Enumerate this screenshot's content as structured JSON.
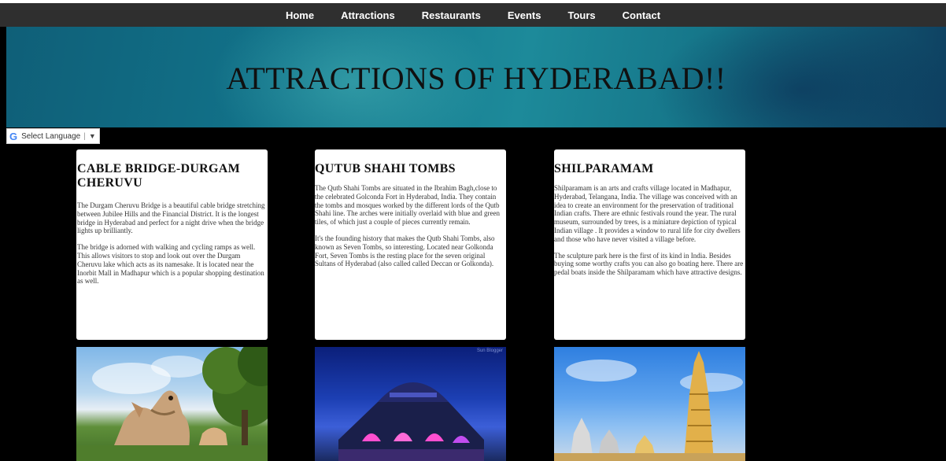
{
  "nav": {
    "items": [
      {
        "label": "Home"
      },
      {
        "label": "Attractions"
      },
      {
        "label": "Restaurants"
      },
      {
        "label": "Events"
      },
      {
        "label": "Tours"
      },
      {
        "label": "Contact"
      }
    ]
  },
  "hero": {
    "title": "ATTRACTIONS OF HYDERABAD!!"
  },
  "translate": {
    "label": "Select Language",
    "icon": "google-g-icon",
    "arrow": "▼"
  },
  "cards": [
    {
      "title": "CABLE BRIDGE-DURGAM CHERUVU",
      "p1": "The Durgam Cheruvu Bridge is a beautiful cable bridge stretching between Jubilee Hills and the Financial District. It is the longest bridge in Hyderabad and perfect for a night drive when the bridge lights up brilliantly.",
      "p2": "The bridge is adorned with walking and cycling ramps as well. This allows visitors to stop and look out over the Durgam Cheruvu lake which acts as its namesake. It is located near the Inorbit Mall in Madhapur which is a popular shopping destination as well."
    },
    {
      "title": "QUTUB SHAHI TOMBS",
      "p1": "The Qutb Shahi Tombs are situated in the Ibrahim Bagh,close to the celebrated Golconda Fort in Hyderabad, India. They contain the tombs and mosques worked by the different lords of the Qutb Shahi line. The arches were initially overlaid with blue and green tiles, of which just a couple of pieces currently remain.",
      "p2": "It's the founding history that makes the Qutb Shahi Tombs, also known as Seven Tombs, so interesting. Located near Golkonda Fort, Seven Tombs is the resting place for the seven original Sultans of Hyderabad (also called called Deccan or Golkonda)."
    },
    {
      "title": "SHILPARAMAM",
      "p1": "Shilparamam is an arts and crafts village located in Madhapur, Hyderabad, Telangana, India. The village was conceived with an idea to create an environment for the preservation of traditional Indian crafts. There are ethnic festivals round the year. The rural museum, surrounded by trees, is a miniature depiction of typical Indian village . It provides a window to rural life for city dwellers and those who have never visited a village before.",
      "p2": "The sculpture park here is the first of its kind in India. Besides buying some worthy crafts you can also go boating here. There are pedal boats inside the Shilparamam which have attractive designs."
    }
  ],
  "images": {
    "credit": "Sun Blogger"
  }
}
